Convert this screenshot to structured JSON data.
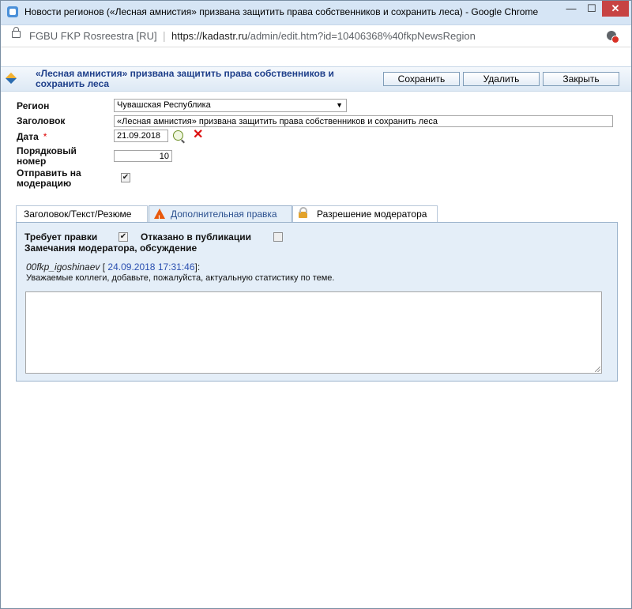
{
  "window": {
    "title": "Новости регионов («Лесная амнистия» призвана защитить права собственников и сохранить леса) - Google Chrome",
    "minimize": "—",
    "maximize": "☐",
    "close": "✕"
  },
  "address": {
    "site": "FGBU FKP Rosreestra [RU]",
    "separator": "|",
    "url_scheme_host": "https://kadastr.ru",
    "url_path": "/admin/edit.htm?id=10406368%40fkpNewsRegion"
  },
  "header": {
    "title": "«Лесная амнистия» призвана защитить права собственников и сохранить леса",
    "buttons": {
      "save": "Сохранить",
      "delete": "Удалить",
      "close": "Закрыть"
    }
  },
  "form": {
    "region_label": "Регион",
    "region_value": "Чувашская Республика",
    "title_label": "Заголовок",
    "title_value": "«Лесная амнистия» призвана защитить права собственников и сохранить леса",
    "date_label": "Дата",
    "date_required": "*",
    "date_value": "21.09.2018",
    "order_label_1": "Порядковый",
    "order_label_2": "номер",
    "order_value": "10",
    "moderation_label_1": "Отправить на",
    "moderation_label_2": "модерацию",
    "moderation_checked": "✔"
  },
  "tabs": {
    "tab1": "Заголовок/Текст/Резюме",
    "tab2": "Дополнительная правка",
    "tab3": "Разрешение модератора"
  },
  "panel": {
    "needs_edit_label": "Требует правки",
    "needs_edit_checked": "✔",
    "rejected_label": "Отказано в публикации",
    "remarks_label": "Замечания модератора, обсуждение",
    "author": "00fkp_igoshinaev",
    "bracket_open": " [ ",
    "timestamp": "24.09.2018 17:31:46",
    "bracket_close": "]:",
    "comment": "Уважаемые коллеги, добавьте, пожалуйста, актуальную статистику по теме."
  }
}
